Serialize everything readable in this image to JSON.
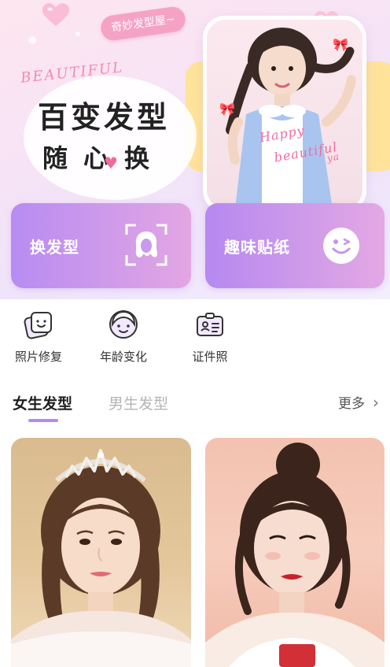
{
  "banner": {
    "tag_text": "奇妙发型屋~",
    "script_text": "BEAUTIFUL",
    "headline_line1": "百变发型",
    "headline_line2": "随心换",
    "photo_text_line1": "Happy",
    "photo_text_line2": "beautiful",
    "photo_text_line3": "ya"
  },
  "features": [
    {
      "label": "换发型",
      "icon": "face-scan-icon"
    },
    {
      "label": "趣味贴纸",
      "icon": "smile-sticker-icon"
    }
  ],
  "tools": [
    {
      "label": "照片修复",
      "icon": "photo-repair-icon"
    },
    {
      "label": "年龄变化",
      "icon": "age-change-icon"
    },
    {
      "label": "证件照",
      "icon": "id-photo-icon"
    }
  ],
  "tabs": {
    "female": "女生发型",
    "male": "男生发型",
    "more": "更多"
  },
  "colors": {
    "accent_purple": "#b18bef",
    "pink": "#f26aa1",
    "card_gradient_start": "#b78cf2",
    "card_gradient_end": "#e3a6e3"
  }
}
